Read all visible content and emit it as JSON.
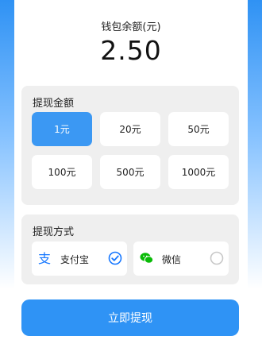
{
  "balance": {
    "label": "钱包余额(元)",
    "value": "2.50"
  },
  "amount_section": {
    "title": "提现金额",
    "options": [
      "1元",
      "20元",
      "50元",
      "100元",
      "500元",
      "1000元"
    ],
    "selected": "1元"
  },
  "method_section": {
    "title": "提现方式",
    "options": [
      {
        "label": "支付宝",
        "icon": "alipay-icon",
        "selected": true
      },
      {
        "label": "微信",
        "icon": "wechat-icon",
        "selected": false
      }
    ]
  },
  "submit": {
    "label": "立即提现"
  },
  "colors": {
    "accent": "#3b98f3",
    "alipay": "#1677ff",
    "wechat": "#09bb07"
  }
}
